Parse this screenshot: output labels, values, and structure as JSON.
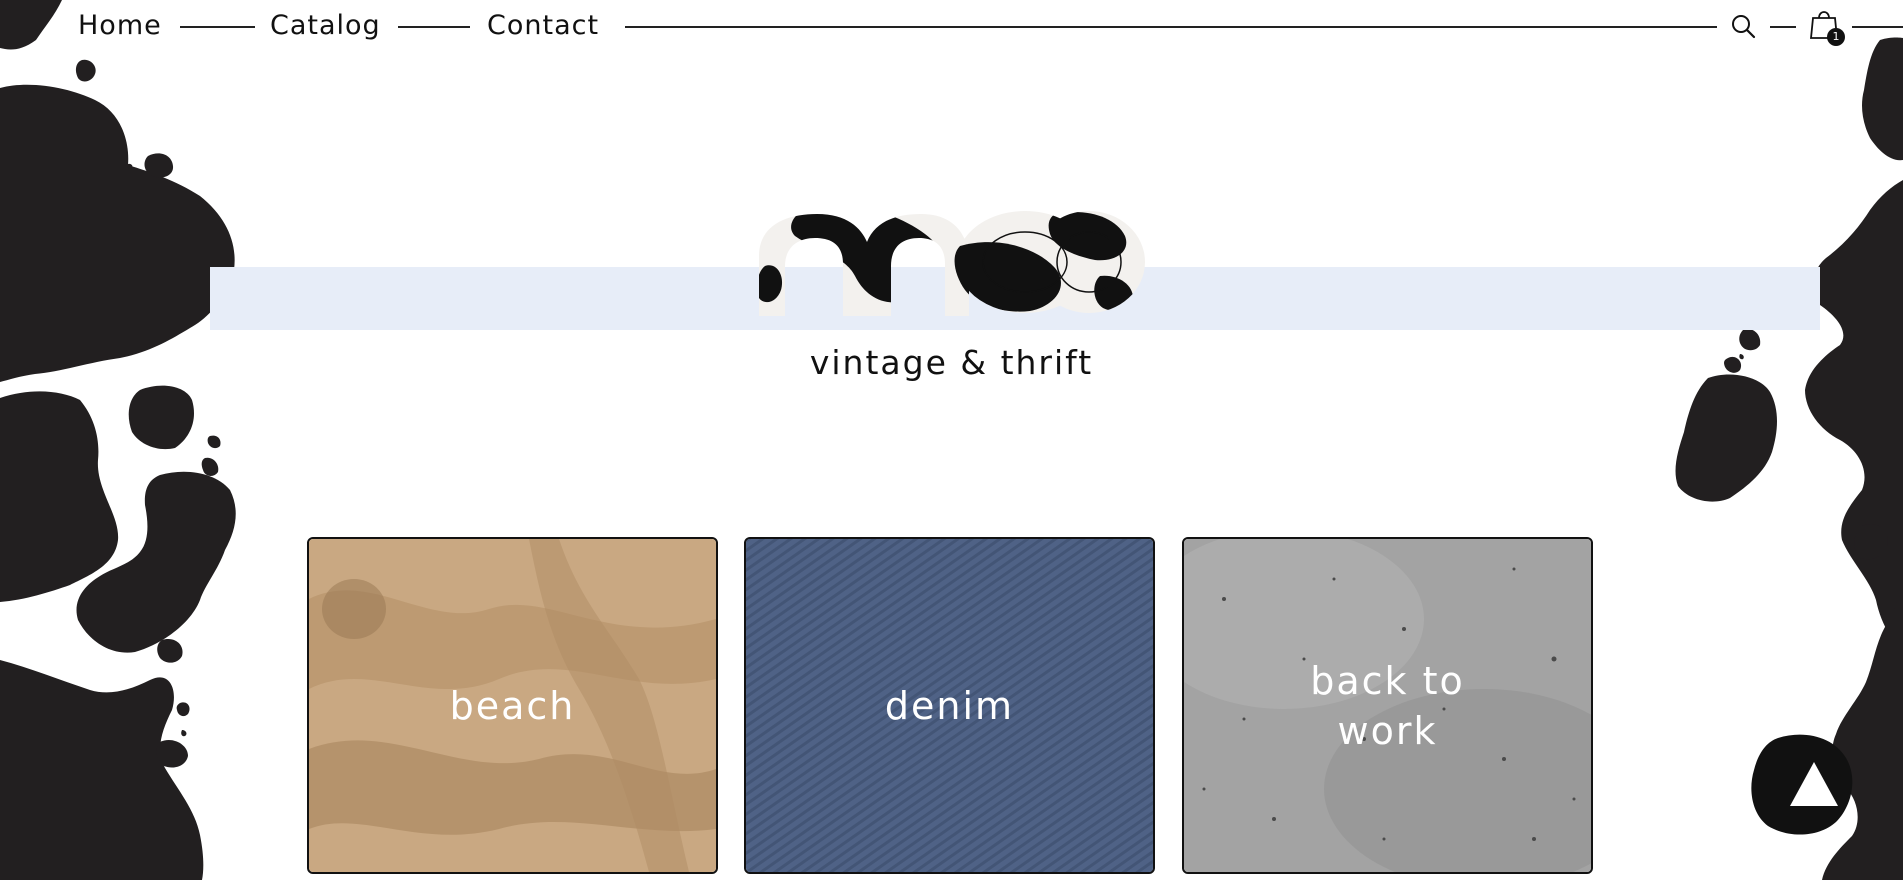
{
  "nav": {
    "links": [
      "Home",
      "Catalog",
      "Contact"
    ],
    "search_icon": "search-icon",
    "cart_icon": "shopping-bag-icon",
    "cart_count": "1"
  },
  "hero": {
    "brand": "moo",
    "tagline": "vintage & thrift",
    "band_color": "#e7edf8"
  },
  "categories": [
    {
      "label": "beach",
      "texture": "sand"
    },
    {
      "label": "denim",
      "texture": "denim"
    },
    {
      "label": "back to work",
      "texture": "concrete"
    }
  ],
  "back_to_top_icon": "triangle-up-icon",
  "colors": {
    "ink": "#221f20",
    "accent": "#e7edf8"
  }
}
